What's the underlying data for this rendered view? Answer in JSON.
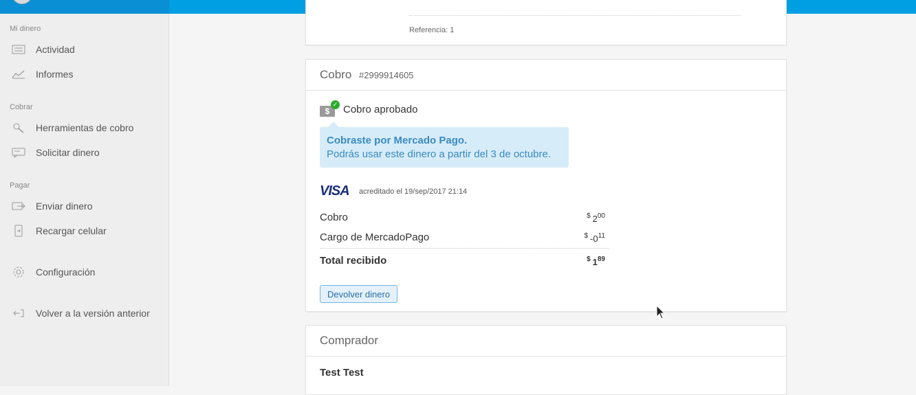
{
  "sidebar": {
    "sections": [
      {
        "title": "Mi dinero",
        "items": [
          {
            "label": "Actividad",
            "icon": "activity-list-icon"
          },
          {
            "label": "Informes",
            "icon": "reports-chart-icon"
          }
        ]
      },
      {
        "title": "Cobrar",
        "items": [
          {
            "label": "Herramientas de cobro",
            "icon": "charge-tools-icon"
          },
          {
            "label": "Solicitar dinero",
            "icon": "request-money-icon"
          }
        ]
      },
      {
        "title": "Pagar",
        "items": [
          {
            "label": "Enviar dinero",
            "icon": "send-money-icon"
          },
          {
            "label": "Recargar celular",
            "icon": "phone-recharge-icon"
          }
        ]
      }
    ],
    "settings": {
      "label": "Configuración",
      "icon": "gear-icon"
    },
    "back_version": {
      "label": "Volver a la versión anterior",
      "icon": "back-arrow-icon"
    }
  },
  "prev_card": {
    "reference": "Referencia: 1"
  },
  "payment_card": {
    "title": "Cobro",
    "id": "#2999914605",
    "status": "Cobro aprobado",
    "info": {
      "strong": "Cobraste por Mercado Pago.",
      "sub": "Podrás usar este dinero a partir del 3 de octubre."
    },
    "card_brand": "VISA",
    "credited": "acreditado el 19/sep/2017 21:14",
    "rows": [
      {
        "label": "Cobro",
        "currency": "$",
        "whole": "2",
        "cents": "00"
      },
      {
        "label": "Cargo de MercadoPago",
        "currency": "$",
        "whole": "-0",
        "cents": "11"
      }
    ],
    "total": {
      "label": "Total recibido",
      "currency": "$",
      "whole": "1",
      "cents": "89"
    },
    "refund_button": "Devolver dinero"
  },
  "buyer_card": {
    "title": "Comprador",
    "name": "Test Test"
  },
  "colors": {
    "topbar": "#009ee3",
    "sidebar_bg": "#eeeeee",
    "info_box": "#d6ecf8",
    "info_text": "#3a8ac2",
    "approved_check": "#2bab2b",
    "button_border": "#78b2de"
  }
}
